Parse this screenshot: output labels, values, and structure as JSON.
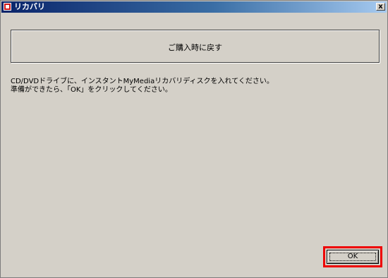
{
  "window": {
    "title": "リカバリ",
    "close_label": "x"
  },
  "restore_button": {
    "label": "ご購入時に戻す"
  },
  "message": {
    "line1": "CD/DVDドライブに、インスタントMyMediaリカバリディスクを入れてください。",
    "line2": "準備ができたら、「OK」をクリックしてください。"
  },
  "ok_button": {
    "label": "OK"
  },
  "colors": {
    "window_bg": "#d4d0c8",
    "highlight": "#ee0000",
    "titlebar": "#0a246a"
  },
  "icons": {
    "app": "app-icon",
    "close": "close-icon"
  }
}
